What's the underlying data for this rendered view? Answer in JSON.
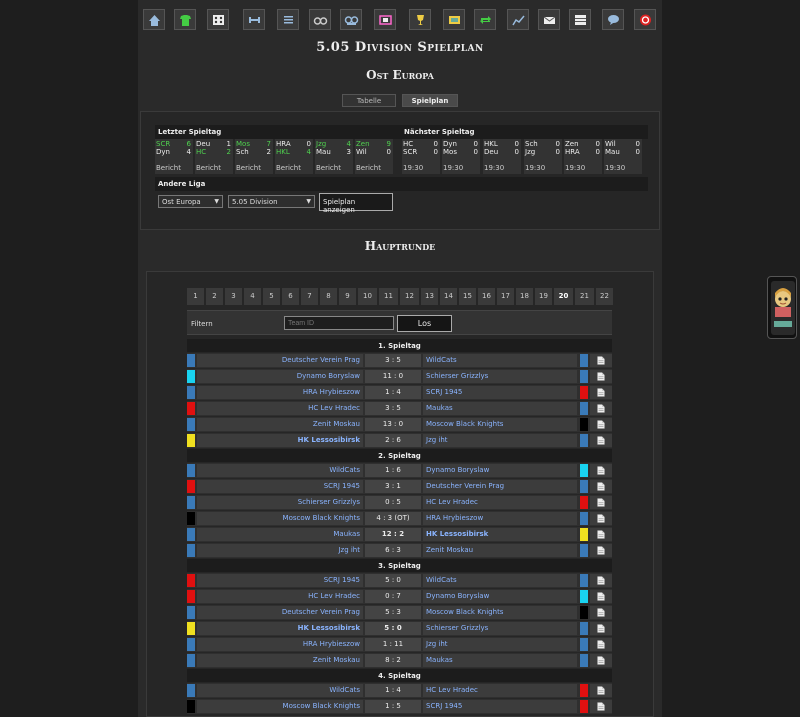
{
  "nav": {
    "icons": [
      "home-icon",
      "jersey-icon",
      "lineup-icon",
      "training-icon",
      "list-icon",
      "binoculars-icon",
      "scout-icon",
      "stadium-icon",
      "trophy-icon",
      "finance-icon",
      "transfer-icon",
      "stats-icon",
      "mail-icon",
      "table-icon",
      "chat-icon",
      "logout-icon"
    ]
  },
  "page": {
    "title": "5.05 Division Spielplan",
    "subtitle": "Ost Europa",
    "tabs": [
      "Tabelle",
      "Spielplan"
    ]
  },
  "summary": {
    "last_label": "Letzter Spieltag",
    "next_label": "Nächster Spieltag",
    "other_label": "Andere Liga",
    "last_games": [
      {
        "t1": "SCR",
        "s1": "6",
        "t2": "Dyn",
        "s2": "4",
        "w": 1,
        "foot": "Bericht"
      },
      {
        "t1": "Deu",
        "s1": "1",
        "t2": "HC",
        "s2": "2",
        "w": 2,
        "foot": "Bericht"
      },
      {
        "t1": "Mos",
        "s1": "7",
        "t2": "Sch",
        "s2": "2",
        "w": 1,
        "foot": "Bericht"
      },
      {
        "t1": "HRA",
        "s1": "0",
        "t2": "HKL",
        "s2": "4",
        "w": 2,
        "foot": "Bericht"
      },
      {
        "t1": "Jzg",
        "s1": "4",
        "t2": "Mau",
        "s2": "3",
        "w": 1,
        "foot": "Bericht"
      },
      {
        "t1": "Zen",
        "s1": "9",
        "t2": "Wil",
        "s2": "0",
        "w": 1,
        "foot": "Bericht"
      }
    ],
    "next_games": [
      {
        "t1": "HC",
        "s1": "0",
        "t2": "SCR",
        "s2": "0",
        "foot": "19:30"
      },
      {
        "t1": "Dyn",
        "s1": "0",
        "t2": "Mos",
        "s2": "0",
        "foot": "19:30"
      },
      {
        "t1": "HKL",
        "s1": "0",
        "t2": "Deu",
        "s2": "0",
        "foot": "19:30"
      },
      {
        "t1": "Sch",
        "s1": "0",
        "t2": "Jzg",
        "s2": "0",
        "foot": "19:30"
      },
      {
        "t1": "Zen",
        "s1": "0",
        "t2": "HRA",
        "s2": "0",
        "foot": "19:30"
      },
      {
        "t1": "Wil",
        "s1": "0",
        "t2": "Mau",
        "s2": "0",
        "foot": "19:30"
      }
    ],
    "league_select": "Ost Europa",
    "division_select": "5.05 Division",
    "show_button": "Spielplan anzeigen"
  },
  "schedule": {
    "title": "Hauptrunde",
    "rounds": [
      "1",
      "2",
      "3",
      "4",
      "5",
      "6",
      "7",
      "8",
      "9",
      "10",
      "11",
      "12",
      "13",
      "14",
      "15",
      "16",
      "17",
      "18",
      "19",
      "20",
      "21",
      "22"
    ],
    "active_round": "20",
    "filter_label": "Filtern",
    "filter_placeholder": "Team ID",
    "filter_button": "Los",
    "days": [
      {
        "label": "1. Spieltag",
        "matches": [
          {
            "home": "Deutscher Verein Prag",
            "score": "3 : 5",
            "away": "WildCats",
            "ch": "#3a7ab8",
            "ca": "#3a7ab8"
          },
          {
            "home": "Dynamo Boryslaw",
            "score": "11 : 0",
            "away": "Schierser Grizzlys",
            "ch": "#19d3f0",
            "ca": "#3a7ab8"
          },
          {
            "home": "HRA Hrybieszow",
            "score": "1 : 4",
            "away": "SCRJ 1945",
            "ch": "#3a7ab8",
            "ca": "#e01010"
          },
          {
            "home": "HC Lev Hradec",
            "score": "3 : 5",
            "away": "Maukas",
            "ch": "#e01010",
            "ca": "#3a7ab8"
          },
          {
            "home": "Zenit Moskau",
            "score": "13 : 0",
            "away": "Moscow Black Knights",
            "ch": "#3a7ab8",
            "ca": "#000000"
          },
          {
            "home": "HK Lessosibirsk",
            "score": "2 : 6",
            "away": "Jzg iht",
            "ch": "#f0e020",
            "ca": "#3a7ab8",
            "hb": true
          }
        ]
      },
      {
        "label": "2. Spieltag",
        "matches": [
          {
            "home": "WildCats",
            "score": "1 : 6",
            "away": "Dynamo Boryslaw",
            "ch": "#3a7ab8",
            "ca": "#19d3f0"
          },
          {
            "home": "SCRJ 1945",
            "score": "3 : 1",
            "away": "Deutscher Verein Prag",
            "ch": "#e01010",
            "ca": "#3a7ab8"
          },
          {
            "home": "Schierser Grizzlys",
            "score": "0 : 5",
            "away": "HC Lev Hradec",
            "ch": "#3a7ab8",
            "ca": "#e01010"
          },
          {
            "home": "Moscow Black Knights",
            "score": "4 : 3 (OT)",
            "away": "HRA Hrybieszow",
            "ch": "#000000",
            "ca": "#3a7ab8"
          },
          {
            "home": "Maukas",
            "score": "12 : 2",
            "away": "HK Lessosibirsk",
            "ch": "#3a7ab8",
            "ca": "#f0e020",
            "ab": true,
            "sb": true
          },
          {
            "home": "Jzg iht",
            "score": "6 : 3",
            "away": "Zenit Moskau",
            "ch": "#3a7ab8",
            "ca": "#3a7ab8"
          }
        ]
      },
      {
        "label": "3. Spieltag",
        "matches": [
          {
            "home": "SCRJ 1945",
            "score": "5 : 0",
            "away": "WildCats",
            "ch": "#e01010",
            "ca": "#3a7ab8"
          },
          {
            "home": "HC Lev Hradec",
            "score": "0 : 7",
            "away": "Dynamo Boryslaw",
            "ch": "#e01010",
            "ca": "#19d3f0"
          },
          {
            "home": "Deutscher Verein Prag",
            "score": "5 : 3",
            "away": "Moscow Black Knights",
            "ch": "#3a7ab8",
            "ca": "#000000"
          },
          {
            "home": "HK Lessosibirsk",
            "score": "5 : 0",
            "away": "Schierser Grizzlys",
            "ch": "#f0e020",
            "ca": "#3a7ab8",
            "hb": true,
            "sb": true
          },
          {
            "home": "HRA Hrybieszow",
            "score": "1 : 11",
            "away": "Jzg iht",
            "ch": "#3a7ab8",
            "ca": "#3a7ab8"
          },
          {
            "home": "Zenit Moskau",
            "score": "8 : 2",
            "away": "Maukas",
            "ch": "#3a7ab8",
            "ca": "#3a7ab8"
          }
        ]
      },
      {
        "label": "4. Spieltag",
        "matches": [
          {
            "home": "WildCats",
            "score": "1 : 4",
            "away": "HC Lev Hradec",
            "ch": "#3a7ab8",
            "ca": "#e01010"
          },
          {
            "home": "Moscow Black Knights",
            "score": "1 : 5",
            "away": "SCRJ 1945",
            "ch": "#000000",
            "ca": "#e01010"
          }
        ]
      }
    ]
  }
}
